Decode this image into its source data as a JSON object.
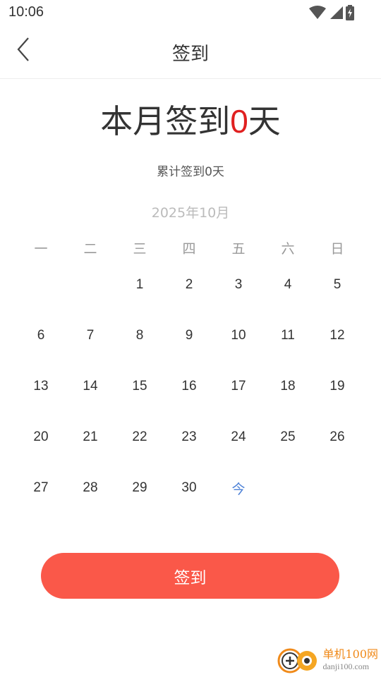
{
  "status_bar": {
    "time": "10:06",
    "icons": [
      "wifi-icon",
      "signal-icon",
      "battery-charging-icon"
    ]
  },
  "header": {
    "title": "签到",
    "back_icon": "chevron-left-icon"
  },
  "summary": {
    "prefix": "本月签到",
    "count": "0",
    "suffix": "天",
    "total_text": "累计签到0天"
  },
  "calendar": {
    "month_label": "2025年10月",
    "weekdays": [
      "一",
      "二",
      "三",
      "四",
      "五",
      "六",
      "日"
    ],
    "leading_blanks": 2,
    "days": [
      "1",
      "2",
      "3",
      "4",
      "5",
      "6",
      "7",
      "8",
      "9",
      "10",
      "11",
      "12",
      "13",
      "14",
      "15",
      "16",
      "17",
      "18",
      "19",
      "20",
      "21",
      "22",
      "23",
      "24",
      "25",
      "26",
      "27",
      "28",
      "29",
      "30",
      "今"
    ],
    "today_label": "今"
  },
  "action": {
    "sign_in_label": "签到"
  },
  "watermark": {
    "name": "单机100网",
    "url": "danji100.com"
  },
  "colors": {
    "accent": "#fa5849",
    "count_red": "#e02020",
    "today_blue": "#4a7fd6"
  }
}
